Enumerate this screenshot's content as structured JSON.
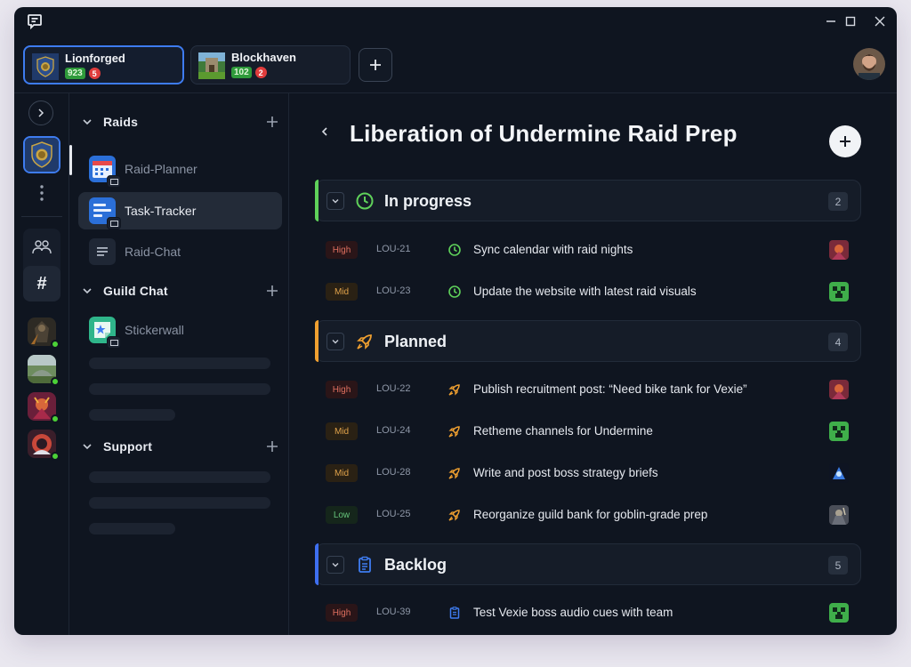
{
  "workspaces": [
    {
      "name": "Lionforged",
      "count": "923",
      "alerts": "5",
      "active": true
    },
    {
      "name": "Blockhaven",
      "count": "102",
      "alerts": "2",
      "active": false
    }
  ],
  "sidebar": {
    "categories": [
      {
        "label": "Raids",
        "channels": [
          {
            "label": "Raid-Planner",
            "icon": "calendar-board-icon",
            "selected": false
          },
          {
            "label": "Task-Tracker",
            "icon": "task-board-icon",
            "selected": true
          },
          {
            "label": "Raid-Chat",
            "icon": "chat-lines-icon",
            "selected": false
          }
        ]
      },
      {
        "label": "Guild Chat",
        "channels": [
          {
            "label": "Stickerwall",
            "icon": "sticker-icon",
            "selected": false
          }
        ]
      },
      {
        "label": "Support",
        "channels": []
      }
    ]
  },
  "main": {
    "title": "Liberation of Undermine Raid Prep",
    "groups": [
      {
        "label": "In progress",
        "count": "2",
        "accent": "#5fd15a",
        "icon": "clock-icon",
        "tasks": [
          {
            "priority": "High",
            "id": "LOU-21",
            "title": "Sync calendar with raid nights",
            "avatar": "demon-avatar"
          },
          {
            "priority": "Mid",
            "id": "LOU-23",
            "title": "Update the website with latest raid visuals",
            "avatar": "creeper-avatar"
          }
        ]
      },
      {
        "label": "Planned",
        "count": "4",
        "accent": "#f0a030",
        "icon": "rocket-icon",
        "tasks": [
          {
            "priority": "High",
            "id": "LOU-22",
            "title": "Publish recruitment post: “Need bike tank for Vexie”",
            "avatar": "demon-avatar"
          },
          {
            "priority": "Mid",
            "id": "LOU-24",
            "title": "Retheme channels for Undermine",
            "avatar": "creeper-avatar"
          },
          {
            "priority": "Mid",
            "id": "LOU-28",
            "title": "Write and post boss strategy briefs",
            "avatar": "mage-avatar"
          },
          {
            "priority": "Low",
            "id": "LOU-25",
            "title": "Reorganize guild bank for goblin-grade prep",
            "avatar": "warrior-avatar"
          }
        ]
      },
      {
        "label": "Backlog",
        "count": "5",
        "accent": "#3e6ff0",
        "icon": "clipboard-icon",
        "tasks": [
          {
            "priority": "High",
            "id": "LOU-39",
            "title": "Test Vexie boss audio cues with team",
            "avatar": "creeper-avatar"
          }
        ]
      }
    ]
  },
  "colors": {
    "accent_blue": "#3e7cf0",
    "online": "#4cd137",
    "in_progress": "#5fd15a",
    "planned": "#f0a030",
    "backlog": "#3e6ff0"
  }
}
